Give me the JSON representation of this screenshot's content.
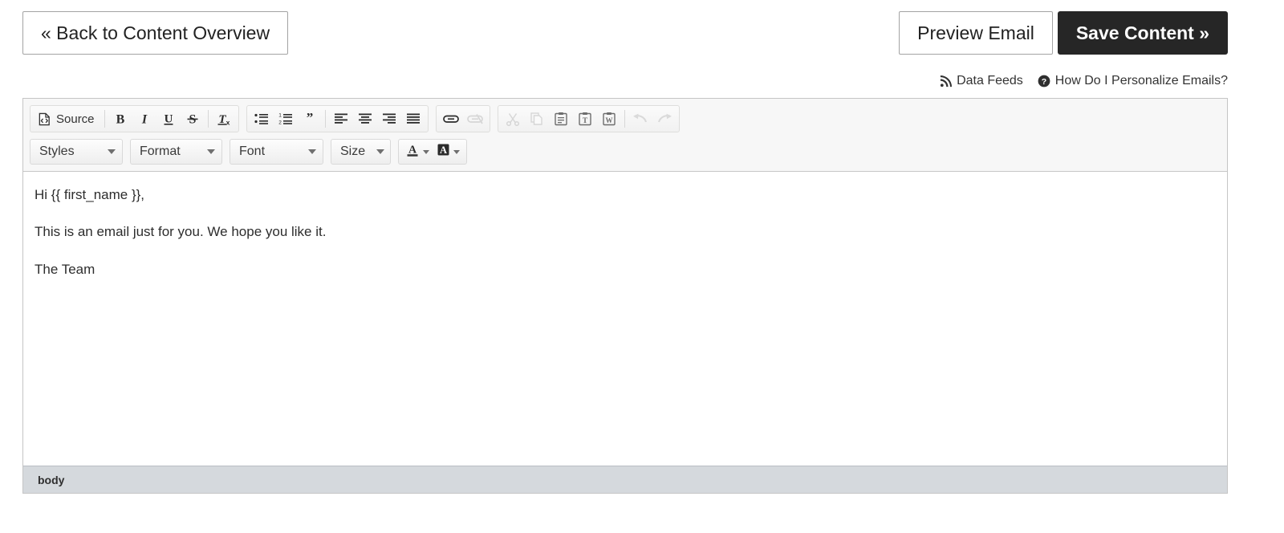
{
  "topbar": {
    "back_button": "« Back to Content Overview",
    "preview_button": "Preview Email",
    "save_button": "Save Content »"
  },
  "helper_links": [
    {
      "icon": "rss-icon",
      "label": "Data Feeds"
    },
    {
      "icon": "question-circle-icon",
      "label": "How Do I Personalize Emails?"
    }
  ],
  "editor": {
    "toolbar": {
      "row1": {
        "source_label": "Source",
        "groups": [
          {
            "name": "document-group",
            "buttons": [
              {
                "name": "source-button",
                "icon": "source-code-icon",
                "label": "Source",
                "disabled": false
              }
            ]
          },
          {
            "name": "basic-styles-group",
            "buttons": [
              {
                "name": "bold-button",
                "icon": "bold-icon",
                "label": "B",
                "disabled": false
              },
              {
                "name": "italic-button",
                "icon": "italic-icon",
                "label": "I",
                "disabled": false
              },
              {
                "name": "underline-button",
                "icon": "underline-icon",
                "label": "U",
                "disabled": false
              },
              {
                "name": "strikethrough-button",
                "icon": "strikethrough-icon",
                "label": "S",
                "disabled": false
              },
              {
                "name": "remove-format-button",
                "icon": "remove-format-icon",
                "label": "Tx",
                "disabled": false
              }
            ]
          },
          {
            "name": "paragraph-group",
            "buttons": [
              {
                "name": "bulleted-list-button",
                "icon": "bulleted-list-icon",
                "disabled": false
              },
              {
                "name": "numbered-list-button",
                "icon": "numbered-list-icon",
                "disabled": false
              },
              {
                "name": "blockquote-button",
                "icon": "blockquote-icon",
                "disabled": false
              },
              {
                "name": "align-left-button",
                "icon": "align-left-icon",
                "disabled": false
              },
              {
                "name": "align-center-button",
                "icon": "align-center-icon",
                "disabled": false
              },
              {
                "name": "align-right-button",
                "icon": "align-right-icon",
                "disabled": false
              },
              {
                "name": "align-justify-button",
                "icon": "align-justify-icon",
                "disabled": false
              }
            ]
          },
          {
            "name": "links-group",
            "buttons": [
              {
                "name": "link-button",
                "icon": "link-icon",
                "disabled": false
              },
              {
                "name": "unlink-button",
                "icon": "unlink-icon",
                "disabled": true
              }
            ]
          },
          {
            "name": "clipboard-group",
            "buttons": [
              {
                "name": "cut-button",
                "icon": "scissors-icon",
                "disabled": true
              },
              {
                "name": "copy-button",
                "icon": "copy-icon",
                "disabled": true
              },
              {
                "name": "paste-button",
                "icon": "paste-icon",
                "disabled": false
              },
              {
                "name": "paste-as-plain-text-button",
                "icon": "paste-text-icon",
                "disabled": false
              },
              {
                "name": "paste-from-word-button",
                "icon": "paste-word-icon",
                "disabled": false
              },
              {
                "name": "undo-button",
                "icon": "undo-arrow-icon",
                "disabled": true
              },
              {
                "name": "redo-button",
                "icon": "redo-arrow-icon",
                "disabled": true
              }
            ]
          }
        ]
      },
      "row2": {
        "styles_label": "Styles",
        "format_label": "Format",
        "font_label": "Font",
        "size_label": "Size",
        "text_color_label": "A",
        "bg_color_label": "A"
      }
    },
    "content": {
      "paragraphs": [
        "Hi {{ first_name }},",
        "This is an email just for you. We hope you like it.",
        "The Team"
      ]
    },
    "statusbar": {
      "element_path": "body"
    }
  },
  "colors": {
    "save_button_bg": "#262626",
    "toolbar_bg": "#f7f7f7",
    "statusbar_bg": "#d5d9dd",
    "editor_border": "#c5c5c5",
    "text": "#2b2b2b"
  }
}
